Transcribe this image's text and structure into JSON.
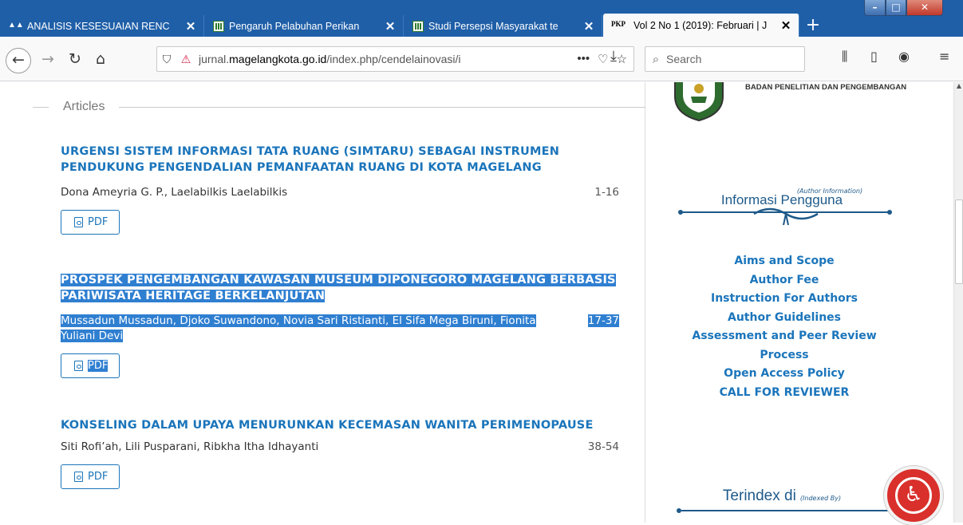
{
  "browser": {
    "tabs": [
      {
        "title": "ANALISIS KESESUAIAN RENC",
        "favicon": "dark-logo-icon"
      },
      {
        "title": "Pengaruh Pelabuhan Perikan",
        "favicon": "journal-icon"
      },
      {
        "title": "Studi Persepsi Masyarakat te",
        "favicon": "journal-icon"
      },
      {
        "title": "Vol 2 No 1 (2019): Februari | J",
        "favicon": "pkp-icon",
        "favicon_text": "PKP",
        "active": true
      }
    ],
    "new_tab_label": "+",
    "url_prefix": "jurnal.",
    "url_domain": "magelangkota.go.id",
    "url_path": "/index.php/cendelainovasi/i",
    "url_actions": [
      "•••",
      "♡",
      "☆"
    ],
    "search_placeholder": "Search"
  },
  "main": {
    "section_title": "Articles",
    "articles": [
      {
        "title": "URGENSI SISTEM INFORMASI TATA RUANG (SIMTARU) SEBAGAI INSTRUMEN PENDUKUNG PENGENDALIAN PEMANFAATAN RUANG DI KOTA MAGELANG",
        "authors": "Dona Ameyria G. P., Laelabilkis Laelabilkis",
        "pages": "1-16",
        "pdf_label": "PDF",
        "selected": false
      },
      {
        "title": "PROSPEK PENGEMBANGAN KAWASAN MUSEUM DIPONEGORO MAGELANG BERBASIS PARIWISATA HERITAGE BERKELANJUTAN",
        "authors": "Mussadun Mussadun, Djoko Suwandono, Novia Sari Ristianti, El Sifa Mega Biruni, Fionita Yuliani Devi",
        "pages": "17-37",
        "pdf_label": "PDF",
        "selected": true
      },
      {
        "title": "KONSELING DALAM UPAYA MENURUNKAN KECEMASAN WANITA PERIMENOPAUSE",
        "authors": "Siti Rofi’ah, Lili Pusparani, Ribkha Itha Idhayanti",
        "pages": "38-54",
        "pdf_label": "PDF",
        "selected": false
      }
    ]
  },
  "sidebar": {
    "logo_text": "BADAN PENELITIAN DAN PENGEMBANGAN",
    "info_title": "Informasi Pengguna",
    "info_subtitle": "(Author Information)",
    "links": [
      "Aims and Scope",
      "Author Fee",
      "Instruction For Authors",
      "Author Guidelines",
      "Assessment and Peer Review",
      "Process",
      "Open Access Policy",
      "CALL FOR REVIEWER"
    ],
    "index_title": "Terindex di",
    "index_subtitle": "(Indexed By)"
  },
  "colors": {
    "tabbar": "#1f5fa8",
    "link": "#1b75bb",
    "selection": "#2f7fd1",
    "accessibility": "#d9302b"
  }
}
